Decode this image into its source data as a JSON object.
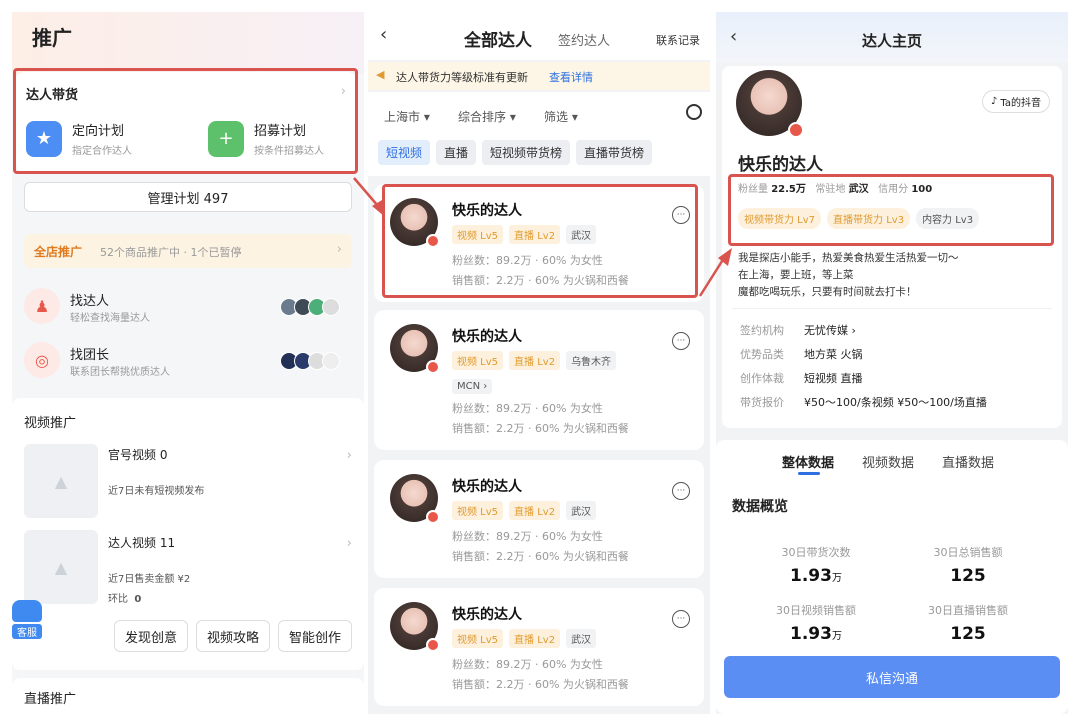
{
  "promo": {
    "title": "推广",
    "kol_section": {
      "title": "达人带货",
      "plan1_title": "定向计划",
      "plan1_sub": "指定合作达人",
      "plan2_title": "招募计划",
      "plan2_sub": "按条件招募达人"
    },
    "manage_label": "管理计划 497",
    "store": {
      "title": "全店推广",
      "text": "52个商品推广中 · 1个已暂停"
    },
    "find_kol": {
      "title": "找达人",
      "sub": "轻松查找海量达人"
    },
    "find_leader": {
      "title": "找团长",
      "sub": "联系团长帮挑优质达人"
    },
    "video_section": {
      "title": "视频推广",
      "item1_title": "官号视频 0",
      "item1_sub": "近7日未有短视频发布",
      "item2_title": "达人视频 11",
      "item2_sub": "近7日售卖金额 ¥2",
      "item2_sub2_label": "环比",
      "item2_sub2_value": "0"
    },
    "buttons": [
      "发现创意",
      "视频攻略",
      "智能创作"
    ],
    "service_label": "客服",
    "live_section": "直播推广"
  },
  "list": {
    "title": "全部达人",
    "tab2": "签约达人",
    "record": "联系记录",
    "notice": "达人带货力等级标准有更新",
    "notice_link": "查看详情",
    "filters": [
      "上海市",
      "综合排序",
      "筛选"
    ],
    "tabs": [
      "短视频",
      "直播",
      "短视频带货榜",
      "直播带货榜"
    ],
    "cards": [
      {
        "name": "快乐的达人",
        "tags": [
          "视频 Lv5",
          "直播 Lv2",
          "武汉"
        ],
        "mcn": "",
        "fans": "粉丝数：89.2万 · 60% 为女性",
        "sales": "销售额：2.2万 · 60% 为火锅和西餐"
      },
      {
        "name": "快乐的达人",
        "tags": [
          "视频 Lv5",
          "直播 Lv2",
          "乌鲁木齐"
        ],
        "mcn": "MCN",
        "fans": "粉丝数：89.2万 · 60% 为女性",
        "sales": "销售额：2.2万 · 60% 为火锅和西餐"
      },
      {
        "name": "快乐的达人",
        "tags": [
          "视频 Lv5",
          "直播 Lv2",
          "武汉"
        ],
        "mcn": "",
        "fans": "粉丝数：89.2万 · 60% 为女性",
        "sales": "销售额：2.2万 · 60% 为火锅和西餐"
      },
      {
        "name": "快乐的达人",
        "tags": [
          "视频 Lv5",
          "直播 Lv2",
          "武汉"
        ],
        "mcn": "",
        "fans": "粉丝数：89.2万 · 60% 为女性",
        "sales": "销售额：2.2万 · 60% 为火锅和西餐"
      }
    ]
  },
  "profile": {
    "title": "达人主页",
    "douyin_btn": "Ta的抖音",
    "name": "快乐的达人",
    "fans_label": "粉丝量",
    "fans_value": "22.5万",
    "city_label": "常驻地",
    "city_value": "武汉",
    "credit_label": "信用分",
    "credit_value": "100",
    "levels": [
      "视频带货力 Lv7",
      "直播带货力 Lv3",
      "内容力 Lv3"
    ],
    "bio": [
      "我是探店小能手，热爱美食热爱生活热爱一切～",
      "在上海，要上班，等上菜",
      "魔都吃喝玩乐，只要有时间就去打卡！"
    ],
    "info": [
      {
        "k": "签约机构",
        "v": "无忧传媒 ›"
      },
      {
        "k": "优势品类",
        "v": "地方菜    火锅"
      },
      {
        "k": "创作体裁",
        "v": "短视频    直播"
      },
      {
        "k": "带货报价",
        "v": "¥50～100/条视频    ¥50～100/场直播"
      }
    ],
    "data_tabs": [
      "整体数据",
      "视频数据",
      "直播数据"
    ],
    "overview_title": "数据概览",
    "stats": [
      {
        "label": "30日带货次数",
        "value": "1.93",
        "unit": "万"
      },
      {
        "label": "30日总销售额",
        "value": "125",
        "unit": ""
      },
      {
        "label": "30日视频销售额",
        "value": "1.93",
        "unit": "万"
      },
      {
        "label": "30日直播销售额",
        "value": "125",
        "unit": ""
      }
    ],
    "message_btn": "私信沟通"
  },
  "colors": {
    "highlight": "#d9544f",
    "brand_blue": "#4d7ff0",
    "orange_tag": "#e09a2f"
  }
}
